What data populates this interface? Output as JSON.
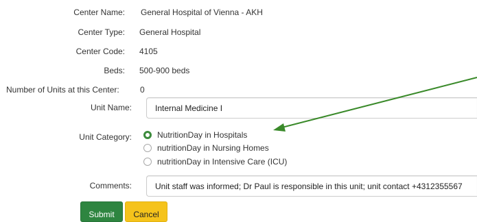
{
  "center": {
    "name_label": "Center Name:",
    "name_value": "General Hospital of Vienna - AKH",
    "type_label": "Center Type:",
    "type_value": "General Hospital",
    "code_label": "Center Code:",
    "code_value": "4105",
    "beds_label": "Beds:",
    "beds_value": "500-900 beds",
    "units_label": "Number of Units at this Center:",
    "units_value": "0"
  },
  "unit": {
    "name_label": "Unit Name:",
    "name_value": "Internal Medicine I",
    "category_label": "Unit Category:",
    "category_options": [
      {
        "label": "NutritionDay in Hospitals",
        "selected": true
      },
      {
        "label": "nutritionDay in Nursing Homes",
        "selected": false
      },
      {
        "label": "nutritionDay in Intensive Care (ICU)",
        "selected": false
      }
    ],
    "comments_label": "Comments:",
    "comments_value": "Unit staff was informed; Dr Paul is responsible in this unit; unit contact +4312355567"
  },
  "buttons": {
    "submit_label": "Submit",
    "cancel_label": "Cancel"
  },
  "colors": {
    "annotation_arrow": "#3a8a2a",
    "radio_checked": "#3c8b3c",
    "submit_bg": "#2e8540",
    "cancel_bg": "#f5c31b"
  }
}
